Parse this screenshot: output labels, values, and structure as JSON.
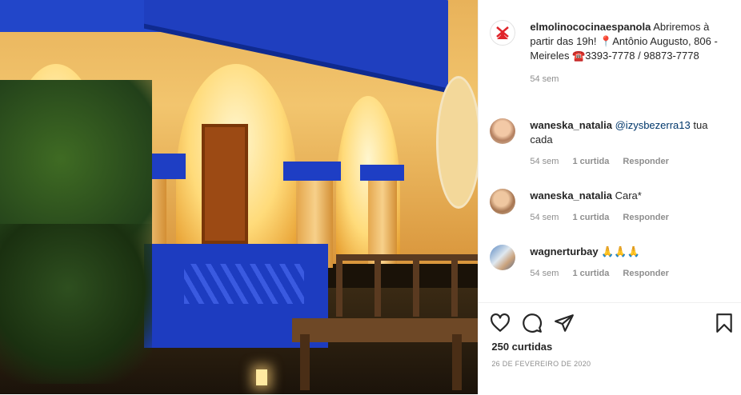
{
  "post": {
    "author": "elmolinococinaespanola",
    "caption_part1": " Abriremos à partir das 19h! ",
    "caption_pin": "📍",
    "caption_part2": "Antônio Augusto, 806 - Meireles ",
    "caption_phone_icon": "☎️",
    "caption_part3": "3393-7778 / 98873-7778",
    "time": "54 sem"
  },
  "comments": [
    {
      "user": "waneska_natalia",
      "mention": "@izysbezerra13",
      "text": " tua cada",
      "time": "54 sem",
      "likes": "1 curtida",
      "reply": "Responder"
    },
    {
      "user": "waneska_natalia",
      "mention": "",
      "text": " Cara*",
      "time": "54 sem",
      "likes": "1 curtida",
      "reply": "Responder"
    },
    {
      "user": "wagnerturbay",
      "mention": "",
      "text": " 🙏🙏🙏",
      "time": "54 sem",
      "likes": "1 curtida",
      "reply": "Responder"
    }
  ],
  "actions": {
    "like_icon": "heart-icon",
    "comment_icon": "comment-icon",
    "share_icon": "share-icon",
    "save_icon": "bookmark-icon"
  },
  "likes": "250 curtidas",
  "date": "26 de fevereiro de 2020",
  "colors": {
    "text": "#262626",
    "secondary": "#8e8e8e",
    "mention": "#00376b",
    "logo_red": "#e0242a"
  }
}
